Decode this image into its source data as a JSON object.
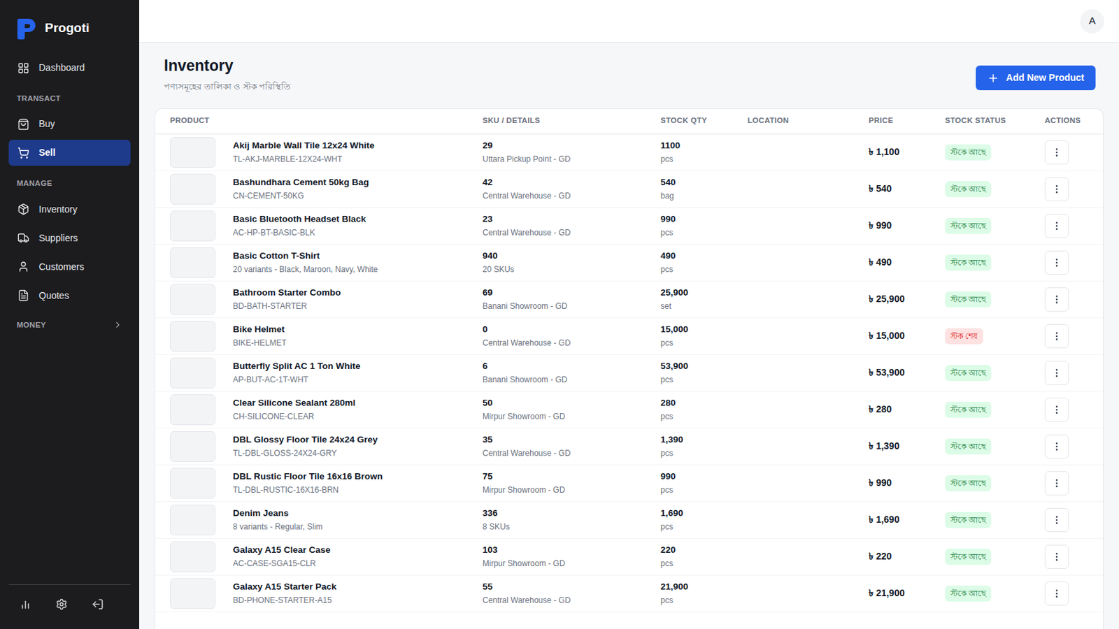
{
  "app": {
    "name": "Progoti"
  },
  "sidebar": {
    "top_items": [
      {
        "label": "Dashboard",
        "selected": false
      }
    ],
    "sections": [
      {
        "heading": "TRANSACT",
        "items": [
          {
            "label": "Buy",
            "selected": false
          },
          {
            "label": "Sell",
            "selected": true
          }
        ]
      },
      {
        "heading": "MANAGE",
        "items": [
          {
            "label": "Inventory",
            "selected": false
          },
          {
            "label": "Suppliers",
            "selected": false
          },
          {
            "label": "Customers",
            "selected": false
          },
          {
            "label": "Quotes",
            "selected": false
          }
        ]
      }
    ],
    "collapsible": [
      {
        "heading": "MONEY",
        "expanded": false
      }
    ]
  },
  "header": {
    "avatar": "A"
  },
  "page": {
    "title": "Inventory",
    "subtitle": "পণ্যসমূহের তালিকা ও স্টক পরিস্থিতি",
    "primary_button": "Add New Product"
  },
  "table": {
    "columns": [
      "PRODUCT",
      "SKU / DETAILS",
      "STOCK QTY",
      "LOCATION",
      "PRICE",
      "STOCK STATUS",
      "ACTIONS"
    ],
    "rows": [
      {
        "name": "Akij Marble Wall Tile 12x24 White",
        "sub": "TL-AKJ-MARBLE-12X24-WHT",
        "detail": "29",
        "detail_sub": "Uttara Pickup Point - GD",
        "qty": "1100",
        "unit": "pcs",
        "price": "৳ 1,100",
        "status": "স্টকে আছে",
        "in_stock": true,
        "color": "#15803d"
      },
      {
        "name": "Bashundhara Cement 50kg Bag",
        "sub": "CN-CEMENT-50KG",
        "detail": "42",
        "detail_sub": "Central Warehouse - GD",
        "qty": "540",
        "unit": "bag",
        "price": "৳ 540",
        "status": "স্টকে আছে",
        "in_stock": true,
        "color": "#15803d"
      },
      {
        "name": "Basic Bluetooth Headset Black",
        "sub": "AC-HP-BT-BASIC-BLK",
        "detail": "23",
        "detail_sub": "Central Warehouse - GD",
        "qty": "990",
        "unit": "pcs",
        "price": "৳ 990",
        "status": "স্টকে আছে",
        "in_stock": true,
        "color": "#15803d"
      },
      {
        "name": "Basic Cotton T-Shirt",
        "sub": "20 variants - Black, Maroon, Navy, White",
        "detail": "940",
        "detail_sub": "20 SKUs",
        "qty": "490",
        "unit": "pcs",
        "price": "৳ 490",
        "status": "স্টকে আছে",
        "in_stock": true,
        "color": "#15803d"
      },
      {
        "name": "Bathroom Starter Combo",
        "sub": "BD-BATH-STARTER",
        "detail": "69",
        "detail_sub": "Banani Showroom - GD",
        "qty": "25,900",
        "unit": "set",
        "price": "৳ 25,900",
        "status": "স্টকে আছে",
        "in_stock": true,
        "color": "#15803d"
      },
      {
        "name": "Bike Helmet",
        "sub": "BIKE-HELMET",
        "detail": "0",
        "detail_sub": "Central Warehouse - GD",
        "qty": "15,000",
        "unit": "pcs",
        "price": "৳ 15,000",
        "status": "স্টক শেষ",
        "in_stock": false,
        "color": "#dc2626"
      },
      {
        "name": "Butterfly Split AC 1 Ton White",
        "sub": "AP-BUT-AC-1T-WHT",
        "detail": "6",
        "detail_sub": "Banani Showroom - GD",
        "qty": "53,900",
        "unit": "pcs",
        "price": "৳ 53,900",
        "status": "স্টকে আছে",
        "in_stock": true,
        "color": "#15803d"
      },
      {
        "name": "Clear Silicone Sealant 280ml",
        "sub": "CH-SILICONE-CLEAR",
        "detail": "50",
        "detail_sub": "Mirpur Showroom - GD",
        "qty": "280",
        "unit": "pcs",
        "price": "৳ 280",
        "status": "স্টকে আছে",
        "in_stock": true,
        "color": "#15803d"
      },
      {
        "name": "DBL Glossy Floor Tile 24x24 Grey",
        "sub": "TL-DBL-GLOSS-24X24-GRY",
        "detail": "35",
        "detail_sub": "Central Warehouse - GD",
        "qty": "1,390",
        "unit": "pcs",
        "price": "৳ 1,390",
        "status": "স্টকে আছে",
        "in_stock": true,
        "color": "#15803d"
      },
      {
        "name": "DBL Rustic Floor Tile 16x16 Brown",
        "sub": "TL-DBL-RUSTIC-16X16-BRN",
        "detail": "75",
        "detail_sub": "Mirpur Showroom - GD",
        "qty": "990",
        "unit": "pcs",
        "price": "৳ 990",
        "status": "স্টকে আছে",
        "in_stock": true,
        "color": "#15803d"
      },
      {
        "name": "Denim Jeans",
        "sub": "8 variants - Regular, Slim",
        "detail": "336",
        "detail_sub": "8 SKUs",
        "qty": "1,690",
        "unit": "pcs",
        "price": "৳ 1,690",
        "status": "স্টকে আছে",
        "in_stock": true,
        "color": "#15803d"
      },
      {
        "name": "Galaxy A15 Clear Case",
        "sub": "AC-CASE-SGA15-CLR",
        "detail": "103",
        "detail_sub": "Mirpur Showroom - GD",
        "qty": "220",
        "unit": "pcs",
        "price": "৳ 220",
        "status": "স্টকে আছে",
        "in_stock": true,
        "color": "#15803d"
      },
      {
        "name": "Galaxy A15 Starter Pack",
        "sub": "BD-PHONE-STARTER-A15",
        "detail": "55",
        "detail_sub": "Central Warehouse - GD",
        "qty": "21,900",
        "unit": "pcs",
        "price": "৳ 21,900",
        "status": "স্টকে আছে",
        "in_stock": true,
        "color": "#15803d"
      }
    ]
  }
}
